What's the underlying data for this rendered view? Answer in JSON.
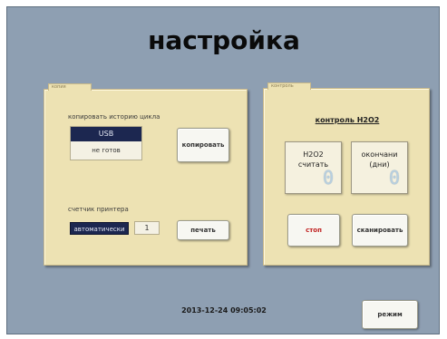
{
  "screen": {
    "title": "настройка",
    "timestamp": "2013-12-24  09:05:02",
    "mode_button": "режим"
  },
  "copy_panel": {
    "tab_label": "копия",
    "copy_label": "копировать историю цикла",
    "usb_label": "USB",
    "usb_status": "не готов",
    "copy_button": "копировать",
    "counter_label": "счетчик принтера",
    "counter_select": "автоматически",
    "counter_value": "1",
    "print_button": "печать"
  },
  "h2o2_panel": {
    "tab_label": "контроль",
    "title": "контроль H2O2",
    "count_label_line1": "H2O2",
    "count_label_line2": "считать",
    "count_value": "0",
    "expiry_label_line1": "окончани",
    "expiry_label_line2": "(дни)",
    "expiry_value": "0",
    "stop_button": "стоп",
    "reset_button": "сканировать"
  }
}
